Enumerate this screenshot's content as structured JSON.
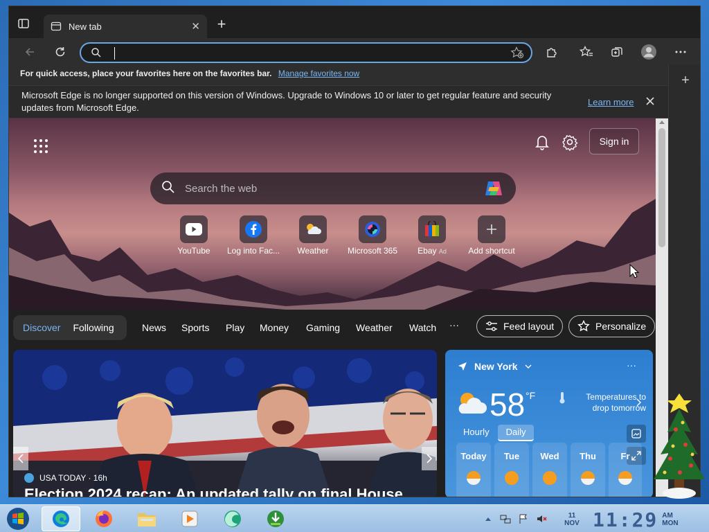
{
  "window": {
    "minimize": "─",
    "maximize": "☐",
    "close": "✕"
  },
  "tab": {
    "title": "New tab",
    "close": "✕"
  },
  "newtab": "+",
  "address": {
    "value": "",
    "placeholder": ""
  },
  "favbar": {
    "text": "For quick access, place your favorites here on the favorites bar.",
    "link": "Manage favorites now"
  },
  "infobar": {
    "message": "Microsoft Edge is no longer supported on this version of Windows. Upgrade to Windows 10 or later to get regular feature and security updates from Microsoft Edge.",
    "learn_more": "Learn more"
  },
  "sidebar": {
    "add": "+"
  },
  "page": {
    "signin": "Sign in",
    "search_placeholder": "Search the web",
    "shortcuts": [
      {
        "label": "YouTube"
      },
      {
        "label": "Log into Fac..."
      },
      {
        "label": "Weather"
      },
      {
        "label": "Microsoft 365"
      },
      {
        "label": "Ebay",
        "ad": "Ad"
      },
      {
        "label": "Add shortcut"
      }
    ]
  },
  "nav": {
    "discover": "Discover",
    "following": "Following",
    "links": [
      "News",
      "Sports",
      "Play",
      "Money",
      "Gaming",
      "Weather",
      "Watch"
    ],
    "more": "···",
    "feed_layout": "Feed layout",
    "personalize": "Personalize"
  },
  "news": {
    "source": "USA TODAY · 16h",
    "headline": "Election 2024 recap: An updated tally on final House"
  },
  "weather": {
    "location": "New York",
    "more": "···",
    "temp": "58",
    "unit": "°F",
    "alert": "Temperatures to drop tomorrow",
    "tab_hourly": "Hourly",
    "tab_daily": "Daily",
    "days": [
      "Today",
      "Tue",
      "Wed",
      "Thu",
      "Fr"
    ]
  },
  "clock": {
    "date_day": "11",
    "date_month": "NOV",
    "time": "11:29",
    "ampm": "AM",
    "weekday": "MON"
  },
  "colors": {
    "accent": "#7ab6f5",
    "window_bg": "#1f1f1f",
    "address_border": "#6aa8e8",
    "weather_bg": "#2d7ed0"
  }
}
